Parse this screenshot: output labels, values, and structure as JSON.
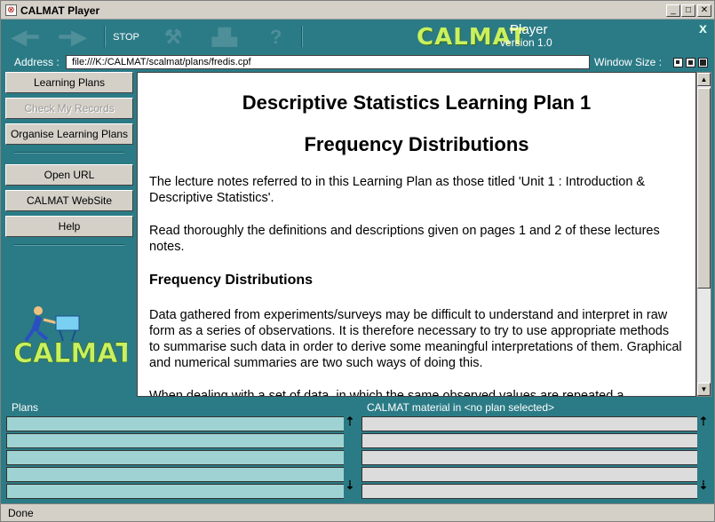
{
  "window": {
    "title": "CALMAT Player",
    "app_icon": "calmat-app-icon",
    "controls": [
      "minimize",
      "maximize",
      "close"
    ]
  },
  "toolbar": {
    "back_icon": "back-arrow-icon",
    "forward_icon": "forward-arrow-icon",
    "stop_label": "STOP",
    "tools_icon": "tools-icon",
    "chart_icon": "chart-icon",
    "help_icon": "question-icon",
    "logo_text": "CALMAT",
    "logo_player": "Player",
    "logo_version": "version 1.0",
    "close_x": "x"
  },
  "address": {
    "label": "Address :",
    "value": "file:///K:/CALMAT/scalmat/plans/fredis.cpf",
    "window_size_label": "Window Size :"
  },
  "sidebar": {
    "buttons_top": [
      "Learning Plans",
      "Check My Records",
      "Organise Learning Plans"
    ],
    "buttons_bottom": [
      "Open URL",
      "CALMAT WebSite",
      "Help"
    ],
    "logo_text": "CALMAT"
  },
  "content": {
    "title": "Descriptive Statistics Learning Plan 1",
    "subtitle": "Frequency Distributions",
    "para1": "The lecture notes referred to in this Learning Plan as those titled 'Unit 1 : Introduction & Descriptive Statistics'.",
    "para2": "Read thoroughly the definitions and descriptions given on pages 1 and 2 of these lectures notes.",
    "heading": "Frequency Distributions",
    "para3": "Data gathered from experiments/surveys may be difficult to understand and interpret in raw form as a series of observations. It is therefore necessary to try to use appropriate methods to summarise such data in order to derive some meaningful interpretations of them. Graphical and numerical summaries are two such ways of doing this.",
    "para4": "When dealing with a set of data, in which the same observed values are repeated a"
  },
  "panels": {
    "plans_label": "Plans",
    "material_label": "CALMAT material in <no plan selected>"
  },
  "colors": {
    "frame": "#2b7b86",
    "plans_row": "#9fd3d3",
    "material_row": "#dcdcdc",
    "logo": "#c8f060"
  },
  "status": {
    "text": "Done"
  }
}
